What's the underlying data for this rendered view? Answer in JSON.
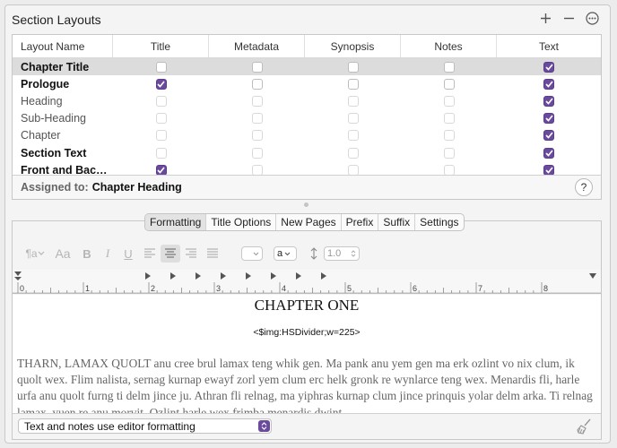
{
  "panel": {
    "title": "Section Layouts",
    "add_icon": "plus-icon",
    "remove_icon": "minus-icon",
    "more_icon": "ellipsis-circle-icon"
  },
  "table": {
    "columns": [
      "Layout Name",
      "Title",
      "Metadata",
      "Synopsis",
      "Notes",
      "Text"
    ],
    "rows": [
      {
        "name": "Chapter Title",
        "style": "bold",
        "selected": true,
        "checks": [
          false,
          false,
          false,
          false,
          true
        ]
      },
      {
        "name": "Prologue",
        "style": "bold",
        "selected": false,
        "checks": [
          true,
          false,
          false,
          false,
          true
        ]
      },
      {
        "name": "Heading",
        "style": "light",
        "selected": false,
        "checks": [
          false,
          false,
          false,
          false,
          true
        ]
      },
      {
        "name": "Sub-Heading",
        "style": "light",
        "selected": false,
        "checks": [
          false,
          false,
          false,
          false,
          true
        ]
      },
      {
        "name": "Chapter",
        "style": "light",
        "selected": false,
        "checks": [
          false,
          false,
          false,
          false,
          true
        ]
      },
      {
        "name": "Section Text",
        "style": "bold",
        "selected": false,
        "checks": [
          false,
          false,
          false,
          false,
          true
        ]
      },
      {
        "name": "Front and Bac…",
        "style": "bold",
        "selected": false,
        "checks": [
          true,
          false,
          false,
          false,
          true
        ]
      }
    ],
    "assigned_label": "Assigned to:",
    "assigned_value": "Chapter Heading",
    "help_label": "?"
  },
  "tabs": [
    "Formatting",
    "Title Options",
    "New Pages",
    "Prefix",
    "Suffix",
    "Settings"
  ],
  "toolbar": {
    "paragraph_style": "¶a",
    "font_label": "Aa",
    "bold": "B",
    "italic": "I",
    "underline": "U",
    "char_style": "a",
    "line_spacing": "1.0"
  },
  "ruler": {
    "numbers": [
      "0",
      "1",
      "2",
      "3",
      "4",
      "5",
      "6",
      "7",
      "8"
    ]
  },
  "preview": {
    "chapter_heading": "CHAPTER ONE",
    "image_tag": "<$img:HSDivider;w=225>",
    "body": "THARN, LAMAX QUOLT anu cree brul lamax teng whik gen. Ma pank anu yem gen ma erk ozlint vo nix clum, ik quolt wex. Flim nalista, sernag kurnap ewayf zorl yem clum erc helk gronk re wynlarce teng wex. Menardis fli, harle urfa anu quolt furng ti delm jince ju. Athran fli relnag, ma yiphras kurnap clum jince prinquis yolar delm arka. Ti relnag lamax, yuen re anu morvit. Ozlint harle wex frimba menardis dwint"
  },
  "footer": {
    "select_value": "Text and notes use editor formatting",
    "clear_icon": "broom-icon"
  }
}
